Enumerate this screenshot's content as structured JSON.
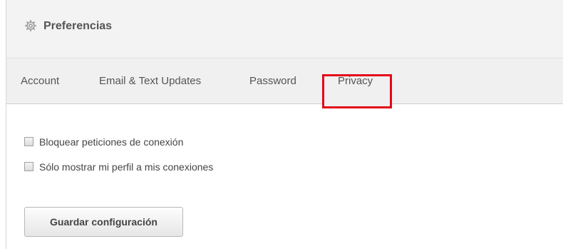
{
  "header": {
    "title": "Preferencias",
    "icon": "gear-icon"
  },
  "tabs": [
    {
      "label": "Account"
    },
    {
      "label": "Email & Text Updates"
    },
    {
      "label": "Password"
    },
    {
      "label": "Privacy",
      "highlighted": true
    }
  ],
  "privacy": {
    "options": [
      {
        "label": "Bloquear peticiones de conexión",
        "checked": false
      },
      {
        "label": "Sólo mostrar mi perfil a mis conexiones",
        "checked": false
      }
    ],
    "save_label": "Guardar configuración"
  },
  "colors": {
    "highlight": "#e3081a"
  }
}
